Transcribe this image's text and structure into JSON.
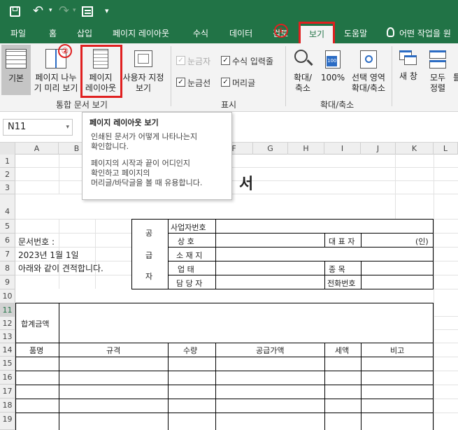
{
  "quick_access": {
    "undo": "↶",
    "more": "▾"
  },
  "tabs": [
    "파일",
    "홈",
    "삽입",
    "페이지 레이아웃",
    "수식",
    "데이터",
    "검토",
    "보기",
    "도움말",
    "어떤 작업을 원"
  ],
  "ribbon": {
    "group1_label": "통합 문서 보기",
    "btn_normal": "기본",
    "btn_pagebreak_l1": "페이지 나누",
    "btn_pagebreak_l2": "기 미리 보기",
    "btn_pagelayout_l1": "페이지",
    "btn_pagelayout_l2": "레이아웃",
    "btn_custom_l1": "사용자 지정",
    "btn_custom_l2": "보기",
    "group2_label": "표시",
    "chk_ruler": "눈금자",
    "chk_formulabar": "수식 입력줄",
    "chk_gridlines": "눈금선",
    "chk_headings": "머리글",
    "group3_label": "확대/축소",
    "btn_zoom_l1": "확대/",
    "btn_zoom_l2": "축소",
    "btn_100": "100%",
    "btn_zoomsel_l1": "선택 영역",
    "btn_zoomsel_l2": "확대/축소",
    "btn_newwin": "새 창",
    "btn_arrange_l1": "모두",
    "btn_arrange_l2": "정렬",
    "btn_cut": "틀"
  },
  "markers": {
    "m1": "①",
    "m2": "②"
  },
  "namebox": "N11",
  "tooltip": {
    "title": "페이지 레이아웃 보기",
    "p1_l1": "인쇄된 문서가 어떻게 나타나는지",
    "p1_l2": "확인합니다.",
    "p2_l1": "페이지의 시작과 끝이 어디인지",
    "p2_l2": "확인하고 페이지의",
    "p2_l3": "머리글/바닥글을 볼 때 유용합니다."
  },
  "columns": [
    "A",
    "B",
    "C",
    "D",
    "E",
    "F",
    "G",
    "H",
    "I",
    "J",
    "K",
    "L"
  ],
  "rows": [
    "1",
    "2",
    "3",
    "4",
    "5",
    "6",
    "7",
    "8",
    "9",
    "10",
    "11",
    "12",
    "13",
    "14",
    "15",
    "16",
    "17",
    "18",
    "19"
  ],
  "sheet": {
    "title_char": "서",
    "doc_no": "문서번호 :",
    "date": "2023년 1월 1일",
    "intro": "아래와 같이 견적합니다.",
    "supplier_chars": [
      "공",
      "급",
      "자"
    ],
    "biz_no": "사업자번호",
    "company": "상    호",
    "address": "소 재 지",
    "biz_type": "업    태",
    "manager": "담 당 자",
    "ceo": "대 표 자",
    "seal": "(인)",
    "item_type": "종    목",
    "phone": "전화번호",
    "total": "합계금액",
    "hdr_item": "품명",
    "hdr_spec": "규격",
    "hdr_qty": "수량",
    "hdr_price": "공급가액",
    "hdr_tax": "세액",
    "hdr_note": "비고"
  },
  "colors": {
    "excel_green": "#217346",
    "marker_red": "#e02020"
  }
}
